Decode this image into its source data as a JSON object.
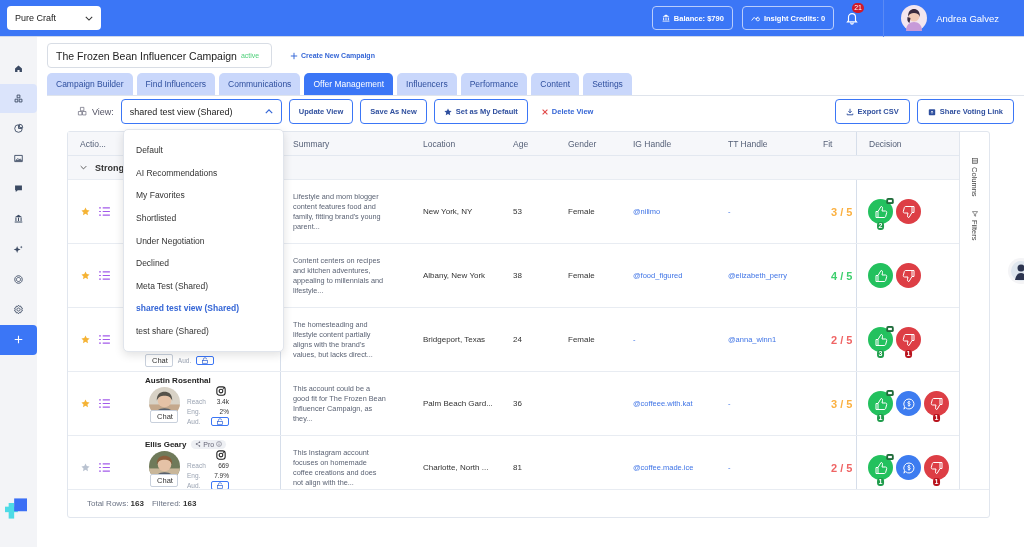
{
  "top_bar": {
    "workspace": "Pure Craft",
    "balance": "Balance: $790",
    "credits": "Insight Credits: 0",
    "notifications": "21",
    "user": "Andrea Galvez"
  },
  "sidebar": {
    "items": [
      {
        "selected": false
      },
      {
        "selected": true
      },
      {
        "selected": false
      },
      {
        "selected": false
      },
      {
        "selected": false
      },
      {
        "selected": false
      },
      {
        "selected": false
      },
      {
        "selected": false
      },
      {
        "selected": false
      }
    ]
  },
  "campaign": {
    "name": "The Frozen Bean Influencer Campaign",
    "status": "active",
    "create_link": "Create New Campaign"
  },
  "tabs": [
    {
      "label": "Campaign Builder",
      "selected": false
    },
    {
      "label": "Find Influencers",
      "selected": false
    },
    {
      "label": "Communications",
      "selected": false
    },
    {
      "label": "Offer Management",
      "selected": true
    },
    {
      "label": "Influencers",
      "selected": false
    },
    {
      "label": "Performance",
      "selected": false
    },
    {
      "label": "Content",
      "selected": false
    },
    {
      "label": "Settings",
      "selected": false
    }
  ],
  "toolbar": {
    "view_label": "View:",
    "view_value": "shared test view (Shared)",
    "dropdown_open": true,
    "buttons": [
      {
        "label": "Update View",
        "kind": "outline"
      },
      {
        "label": "Save As New",
        "kind": "outline"
      },
      {
        "label": "Set as My Default",
        "kind": "star"
      },
      {
        "label": "Delete View",
        "kind": "delete"
      }
    ],
    "right_buttons": [
      {
        "label": "Export CSV",
        "kind": "export"
      },
      {
        "label": "Share Voting Link",
        "kind": "share"
      }
    ]
  },
  "view_options": [
    {
      "label": "Default",
      "selected": false
    },
    {
      "label": "AI Recommendations",
      "selected": false
    },
    {
      "label": "My Favorites",
      "selected": false
    },
    {
      "label": "Shortlisted",
      "selected": false
    },
    {
      "label": "Under Negotiation",
      "selected": false
    },
    {
      "label": "Declined",
      "selected": false
    },
    {
      "label": "Meta Test (Shared)",
      "selected": false
    },
    {
      "label": "shared test view (Shared)",
      "selected": true
    },
    {
      "label": "test share (Shared)",
      "selected": false
    }
  ],
  "table": {
    "columns": [
      "Actio...",
      "Summary",
      "Location",
      "Age",
      "Gender",
      "IG Handle",
      "TT Handle",
      "Fit",
      "Decision"
    ],
    "group": {
      "label": "Strong",
      "expanded": true
    },
    "rows": [
      {
        "favorite": true,
        "summary": "Lifestyle and mom blogger content features food and family, fitting brand's young parent...",
        "location": "New York, NY",
        "age": "53",
        "gender": "Female",
        "ig": "@nilimo",
        "tt": "-",
        "fit": {
          "text": "3 / 5",
          "color": "#fbb040"
        },
        "decisions": [
          {
            "kind": "like",
            "count": "2",
            "comment": true
          },
          {
            "kind": "dislike",
            "comment": false
          }
        ]
      },
      {
        "favorite": true,
        "summary": "Content centers on recipes and kitchen adventures, appealing to millennials and lifestyle...",
        "location": "Albany, New York",
        "age": "38",
        "gender": "Female",
        "ig": "@food_figured",
        "tt": "@elizabeth_perry",
        "fit": {
          "text": "4 / 5",
          "color": "#3ecf6e"
        },
        "decisions": [
          {
            "kind": "like",
            "comment": false
          },
          {
            "kind": "dislike",
            "comment": false
          }
        ]
      },
      {
        "favorite": true,
        "profile": {
          "kind": "partial",
          "chat": "Chat",
          "stats": [
            {
              "label": "Aud.",
              "kind": "lock"
            }
          ]
        },
        "summary": "The homesteading and lifestyle content partially aligns with the brand's values, but lacks direct...",
        "location": "Bridgeport, Texas",
        "age": "24",
        "gender": "Female",
        "ig": "-",
        "tt": "@anna_winn1",
        "fit": {
          "text": "2 / 5",
          "color": "#ef6464"
        },
        "decisions": [
          {
            "kind": "like",
            "count": "3",
            "comment": true
          },
          {
            "kind": "dislike",
            "count": "1",
            "comment": false
          }
        ]
      },
      {
        "favorite": true,
        "profile": {
          "kind": "full",
          "name": "Austin Rosenthal",
          "chat": "Chat",
          "stats": [
            {
              "label": "Reach",
              "value": "3.4k",
              "kind": "value"
            },
            {
              "label": "Eng.",
              "value": "2%",
              "kind": "value"
            },
            {
              "label": "Aud.",
              "kind": "lock"
            }
          ]
        },
        "summary": "This account could be a good fit for The Frozen Bean Influencer Campaign, as they...",
        "location": "Palm Beach Gard...",
        "age": "36",
        "ig": "@coffeee.with.kat",
        "tt": "-",
        "fit": {
          "text": "3 / 5",
          "color": "#fbb040"
        },
        "decisions": [
          {
            "kind": "like",
            "count": "1",
            "comment": true
          },
          {
            "kind": "offer",
            "comment": false
          },
          {
            "kind": "dislike",
            "count": "1",
            "comment": false
          }
        ]
      },
      {
        "favorite": false,
        "profile": {
          "kind": "full",
          "name": "Ellis Geary",
          "badge": "Pro",
          "chat": "Chat",
          "stats": [
            {
              "label": "Reach",
              "value": "669",
              "kind": "value"
            },
            {
              "label": "Eng.",
              "value": "7.9%",
              "kind": "value"
            },
            {
              "label": "Aud.",
              "kind": "lock"
            }
          ]
        },
        "summary": "This Instagram account focuses on homemade coffee creations and does not align with the...",
        "location": "Charlotte, North ...",
        "age": "81",
        "ig": "@coffee.made.ice",
        "tt": "-",
        "fit": {
          "text": "2 / 5",
          "color": "#ef6464"
        },
        "decisions": [
          {
            "kind": "like",
            "count": "1",
            "comment": true
          },
          {
            "kind": "offer",
            "comment": false
          },
          {
            "kind": "dislike",
            "count": "1",
            "comment": false
          }
        ]
      }
    ],
    "side_panel": [
      "Columns",
      "Filters"
    ],
    "footer": [
      {
        "text": "Total Rows: **163**"
      },
      {
        "text": "Filtered: **163**"
      }
    ]
  }
}
